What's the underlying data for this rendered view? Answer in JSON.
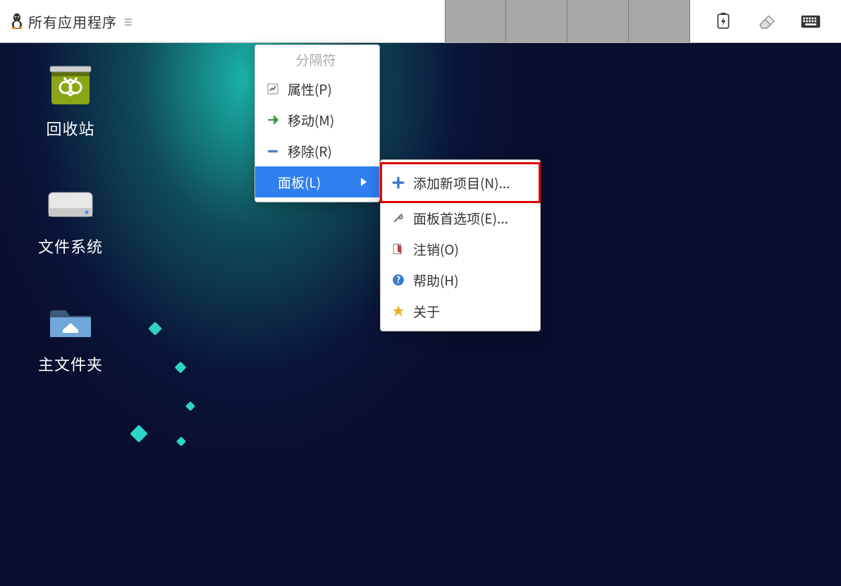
{
  "panel": {
    "app_menu_label": "所有应用程序"
  },
  "desktop_icons": {
    "trash": "回收站",
    "filesystem": "文件系统",
    "home": "主文件夹"
  },
  "context_menu": {
    "separator": "分隔符",
    "properties": "属性(P)",
    "move": "移动(M)",
    "remove": "移除(R)",
    "panel": "面板(L)"
  },
  "submenu": {
    "add_item": "添加新项目(N)...",
    "panel_prefs": "面板首选项(E)...",
    "logout": "注销(O)",
    "help": "帮助(H)",
    "about": "关于"
  }
}
